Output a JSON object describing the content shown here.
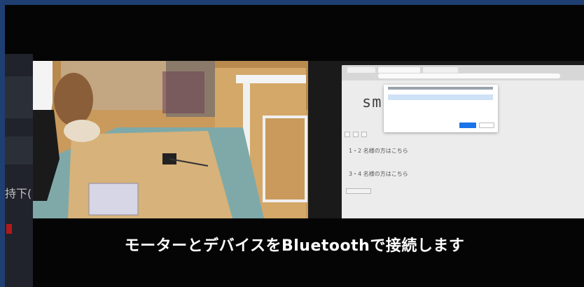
{
  "caption": "モーターとデバイスをBluetoothで接続します",
  "left_strip": {
    "text": "持下(",
    "accent_color": "#b31818"
  },
  "browser": {
    "brand_fragment": "sm",
    "dialog": {
      "pair_label": "",
      "cancel_label": ""
    },
    "links": [
      "1・2 名様の方はこちら",
      "3・4 名様の方はこちら"
    ]
  },
  "colors": {
    "frame": "#1f3f73",
    "background": "#050505",
    "caption": "#ffffff"
  }
}
